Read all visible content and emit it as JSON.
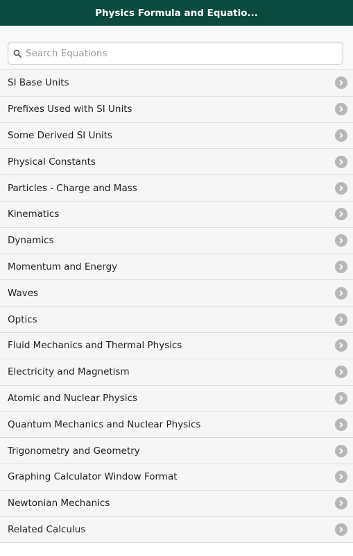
{
  "header": {
    "title": "Physics Formula and Equatio..."
  },
  "search": {
    "placeholder": "Search Equations",
    "value": ""
  },
  "list": {
    "items": [
      {
        "label": "SI Base Units"
      },
      {
        "label": "Prefixes Used with SI Units"
      },
      {
        "label": "Some Derived SI Units"
      },
      {
        "label": "Physical Constants"
      },
      {
        "label": "Particles - Charge and Mass"
      },
      {
        "label": "Kinematics"
      },
      {
        "label": "Dynamics"
      },
      {
        "label": "Momentum and Energy"
      },
      {
        "label": "Waves"
      },
      {
        "label": "Optics"
      },
      {
        "label": "Fluid Mechanics and Thermal Physics"
      },
      {
        "label": "Electricity and Magnetism"
      },
      {
        "label": "Atomic and Nuclear Physics"
      },
      {
        "label": "Quantum Mechanics and Nuclear Physics"
      },
      {
        "label": "Trigonometry and Geometry"
      },
      {
        "label": "Graphing Calculator Window Format"
      },
      {
        "label": "Newtonian Mechanics"
      },
      {
        "label": "Related Calculus"
      }
    ],
    "item_icon": "chevron-right-icon"
  },
  "colors": {
    "header_bg": "#0b4a3e",
    "header_text": "#ffffff",
    "row_bg": "#f6f6f6",
    "chevron_bg": "#b7b7b7"
  }
}
